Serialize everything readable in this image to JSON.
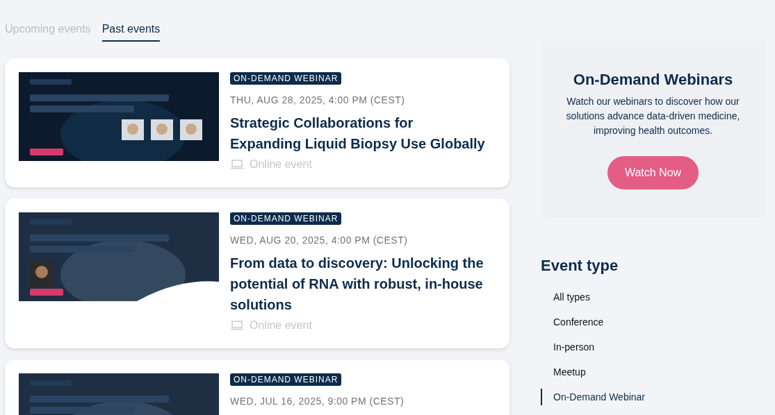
{
  "tabs": [
    {
      "label": "Upcoming events",
      "selected": false
    },
    {
      "label": "Past events",
      "selected": true
    }
  ],
  "events": [
    {
      "badge": "ON-DEMAND WEBINAR",
      "date": "THU, AUG 28, 2025, 4:00 PM (CEST)",
      "title": "Strategic Collaborations for Expanding Liquid Biopsy Use Globally",
      "location": "Online event"
    },
    {
      "badge": "ON-DEMAND WEBINAR",
      "date": "WED, AUG 20, 2025, 4:00 PM (CEST)",
      "title": "From data to discovery: Unlocking the potential of RNA with robust, in-house solutions",
      "location": "Online event"
    },
    {
      "badge": "ON-DEMAND WEBINAR",
      "date": "WED, JUL 16, 2025, 9:00 PM (CEST)"
    }
  ],
  "promo": {
    "title": "On-Demand Webinars",
    "text": "Watch our webinars to discover how our solutions advance data-driven medicine, improving health outcomes.",
    "button": "Watch Now"
  },
  "filter": {
    "title": "Event type",
    "items": [
      {
        "label": "All types",
        "selected": false
      },
      {
        "label": "Conference",
        "selected": false
      },
      {
        "label": "In-person",
        "selected": false
      },
      {
        "label": "Meetup",
        "selected": false
      },
      {
        "label": "On-Demand Webinar",
        "selected": true
      }
    ]
  }
}
